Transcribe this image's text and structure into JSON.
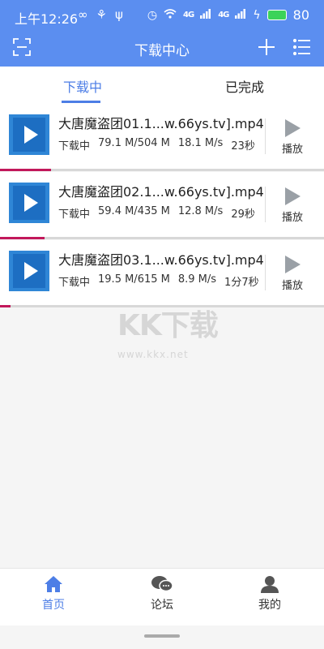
{
  "status_bar": {
    "time": "上午12:26",
    "battery": "80",
    "signal_label": "4G"
  },
  "header": {
    "title": "下载中心"
  },
  "tabs": [
    {
      "label": "下载中",
      "active": true
    },
    {
      "label": "已完成",
      "active": false
    }
  ],
  "downloads": [
    {
      "name": "大唐魔盗团01.1...w.66ys.tv].mp4",
      "status": "下载中",
      "size": "79.1 M/504 M",
      "speed": "18.1 M/s",
      "eta": "23秒",
      "progress": 0.157,
      "action": "播放"
    },
    {
      "name": "大唐魔盗团02.1...w.66ys.tv].mp4",
      "status": "下载中",
      "size": "59.4 M/435 M",
      "speed": "12.8 M/s",
      "eta": "29秒",
      "progress": 0.137,
      "action": "播放"
    },
    {
      "name": "大唐魔盗团03.1...w.66ys.tv].mp4",
      "status": "下载中",
      "size": "19.5 M/615 M",
      "speed": "8.9 M/s",
      "eta": "1分7秒",
      "progress": 0.032,
      "action": "播放"
    }
  ],
  "watermark": {
    "brand": "KK下载",
    "url": "www.kkx.net"
  },
  "bottom_nav": [
    {
      "label": "首页",
      "icon": "home-icon",
      "active": true
    },
    {
      "label": "论坛",
      "icon": "chat-icon",
      "active": false
    },
    {
      "label": "我的",
      "icon": "user-icon",
      "active": false
    }
  ],
  "colors": {
    "header_bg": "#5b8ef0",
    "accent": "#4d7ee6",
    "progress": "#c2185b",
    "thumb": "#2f86d6"
  }
}
